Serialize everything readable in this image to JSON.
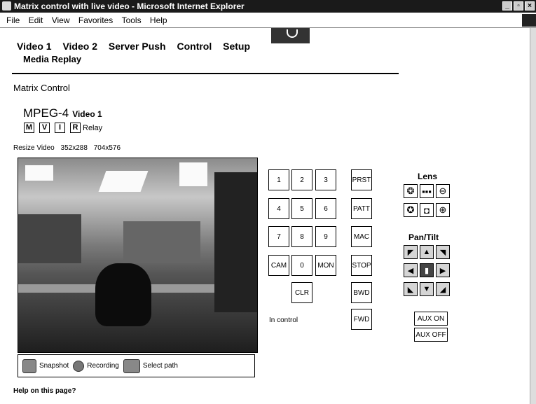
{
  "window": {
    "title": "Matrix control with live video - Microsoft Internet Explorer"
  },
  "menu": [
    {
      "label": "File"
    },
    {
      "label": "Edit"
    },
    {
      "label": "View"
    },
    {
      "label": "Favorites"
    },
    {
      "label": "Tools"
    },
    {
      "label": "Help"
    }
  ],
  "nav": {
    "items": [
      "Video 1",
      "Video 2",
      "Server Push",
      "Control",
      "Setup"
    ],
    "second_line": "Media Replay"
  },
  "section_title": "Matrix Control",
  "stream": {
    "codec": "MPEG-4",
    "channel": "Video 1"
  },
  "mode_badges": [
    "M",
    "V",
    "I",
    "R"
  ],
  "relay_label": "Relay",
  "resize": {
    "label": "Resize Video",
    "options": [
      "352x288",
      "704x576"
    ]
  },
  "toolbar": {
    "snapshot": "Snapshot",
    "recording": "Recording",
    "select_path": "Select path"
  },
  "help_link": "Help on this page?",
  "keypad": [
    "1",
    "2",
    "3",
    "4",
    "5",
    "6",
    "7",
    "8",
    "9",
    "CAM",
    "0",
    "MON",
    "CLR"
  ],
  "functions": [
    "PRST",
    "PATT",
    "MAC",
    "STOP",
    "BWD",
    "FWD"
  ],
  "status": "In control",
  "lens": {
    "title": "Lens"
  },
  "pantilt": {
    "title": "Pan/Tilt"
  },
  "aux": {
    "on": "AUX ON",
    "off": "AUX OFF"
  }
}
